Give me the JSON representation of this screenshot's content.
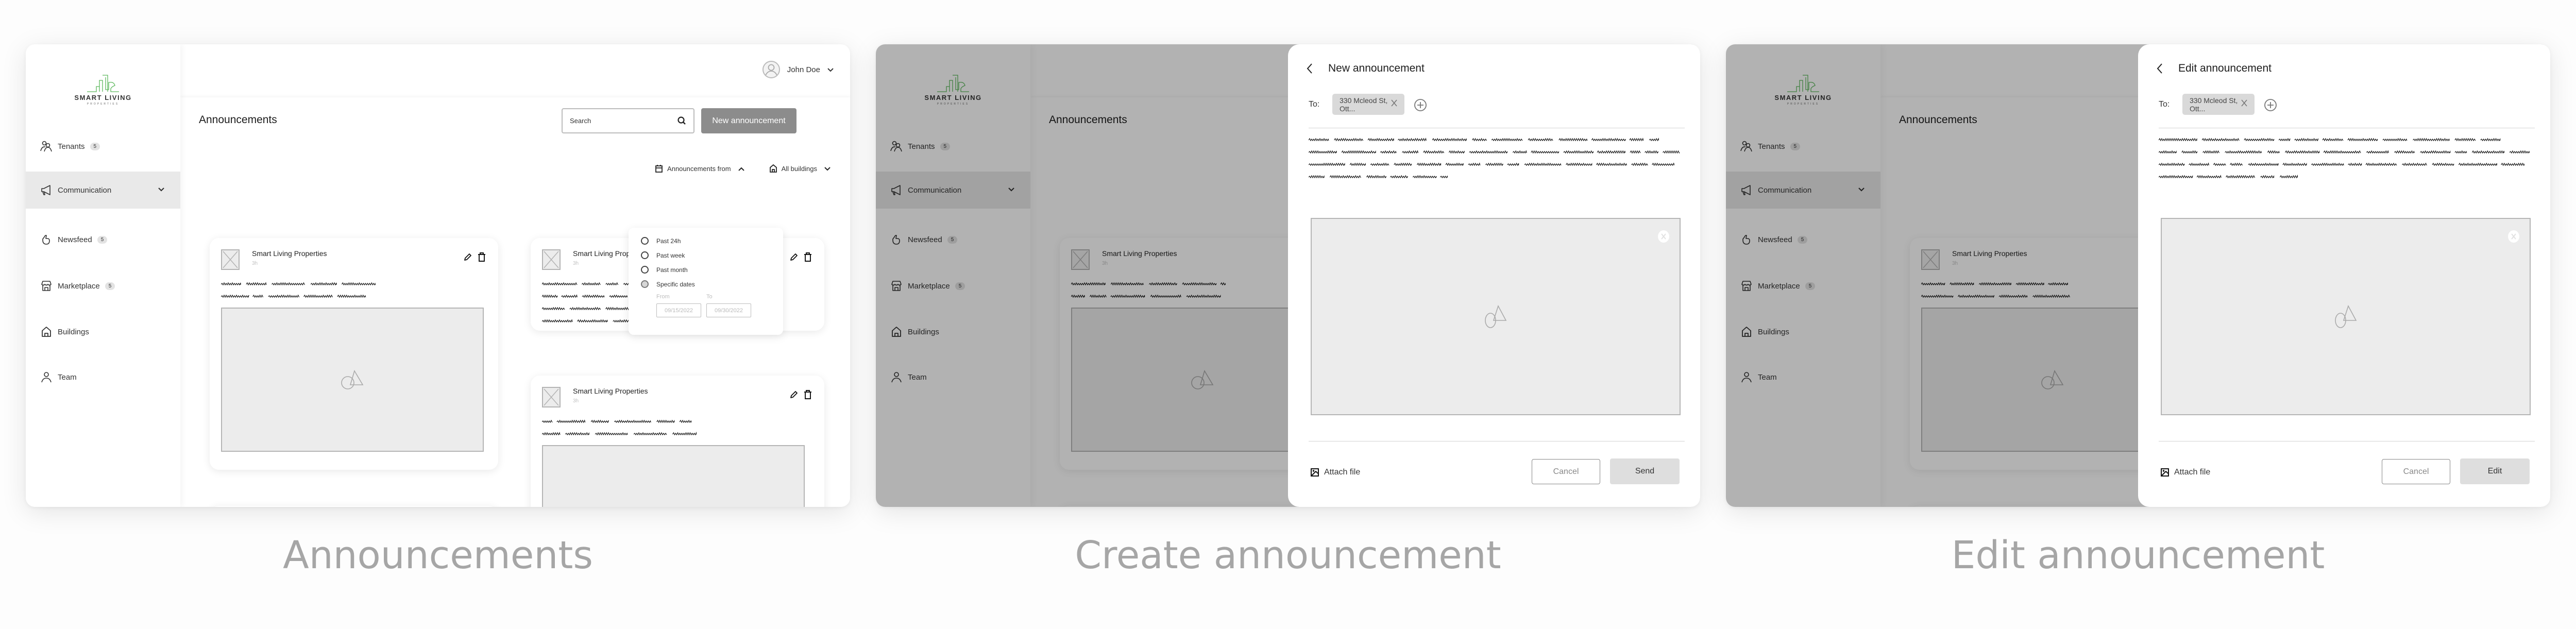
{
  "captions": [
    "Announcements",
    "Create announcement",
    "Edit announcement"
  ],
  "brand": {
    "name": "SMART LIVING",
    "tagline": "PROPERTIES",
    "logo_color": "#5cb85c"
  },
  "sidebar": {
    "items": [
      {
        "label": "Tenants",
        "icon": "users-icon",
        "badge": "5"
      },
      {
        "label": "Communication",
        "icon": "megaphone-icon",
        "active": true,
        "expandable": true
      },
      {
        "label": "Newsfeed",
        "icon": "thumbs-up-icon",
        "badge": "5"
      },
      {
        "label": "Marketplace",
        "icon": "store-icon",
        "badge": "5"
      },
      {
        "label": "Buildings",
        "icon": "home-icon"
      },
      {
        "label": "Team",
        "icon": "user-icon"
      }
    ]
  },
  "user": {
    "name": "John Doe"
  },
  "header": {
    "title": "Announcements",
    "search_placeholder": "Search",
    "new_button": "New announcement"
  },
  "filters": {
    "date_label": "Announcements from",
    "building_label": "All buildings",
    "date_options": [
      "Past 24h",
      "Past week",
      "Past month",
      "Specific dates"
    ],
    "selected_option": "Specific dates",
    "from_label": "From",
    "to_label": "To",
    "from_value": "09/15/2022",
    "to_value": "09/30/2022"
  },
  "cards": [
    {
      "org": "Smart Living  Properties",
      "time": "3h"
    },
    {
      "org": "Smart Living  Properties",
      "time": "3h"
    },
    {
      "org": "Smart Living  Properties",
      "time": "3h"
    },
    {
      "org": "Smart Living  Properties",
      "time": "3h"
    }
  ],
  "create_modal": {
    "title": "New announcement",
    "to_label": "To:",
    "recipient": "330 Mcleod St, Ott...",
    "attach_label": "Attach file",
    "cancel_label": "Cancel",
    "primary_label": "Send"
  },
  "edit_modal": {
    "title": "Edit announcement",
    "to_label": "To:",
    "recipient": "330 Mcleod St, Ott...",
    "attach_label": "Attach file",
    "cancel_label": "Cancel",
    "primary_label": "Edit"
  },
  "colors": {
    "accent_button": "#8c8c8c",
    "active_nav": "#e9e9e9",
    "placeholder_fill": "#ececec",
    "caption": "#a6a6a6"
  }
}
